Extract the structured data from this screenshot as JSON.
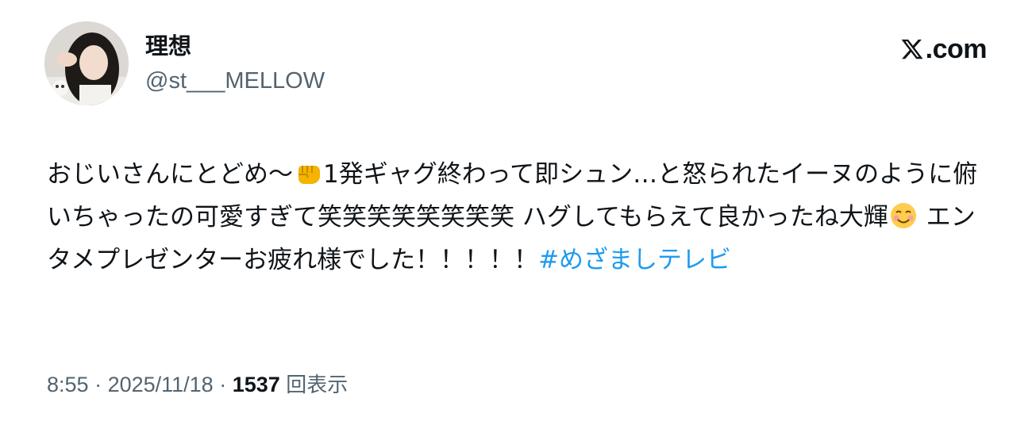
{
  "author": {
    "display_name": "理想",
    "handle": "@st___MELLOW"
  },
  "brand": {
    "label": ".com",
    "icon": "x-logo-icon"
  },
  "tweet": {
    "segment_1": "おじいさんにとどめ〜",
    "emoji_1": "fist-emoji",
    "segment_2": "1発ギャグ終わって即シュン…と怒られたイーヌのように俯いちゃったの可愛すぎて笑笑笑笑笑笑笑笑 ハグしてもらえて良かったね大輝",
    "emoji_2": "smiling-face-emoji",
    "segment_3": " エンタメプレゼンターお疲れ様でした！！！！！",
    "hashtag": "#めざましテレビ"
  },
  "meta": {
    "time": "8:55",
    "separator": " · ",
    "date": "2025/11/18",
    "views_count": "1537",
    "views_label": "回表示"
  },
  "colors": {
    "text": "#0f1419",
    "secondary": "#536471",
    "link": "#1d9bf0"
  }
}
